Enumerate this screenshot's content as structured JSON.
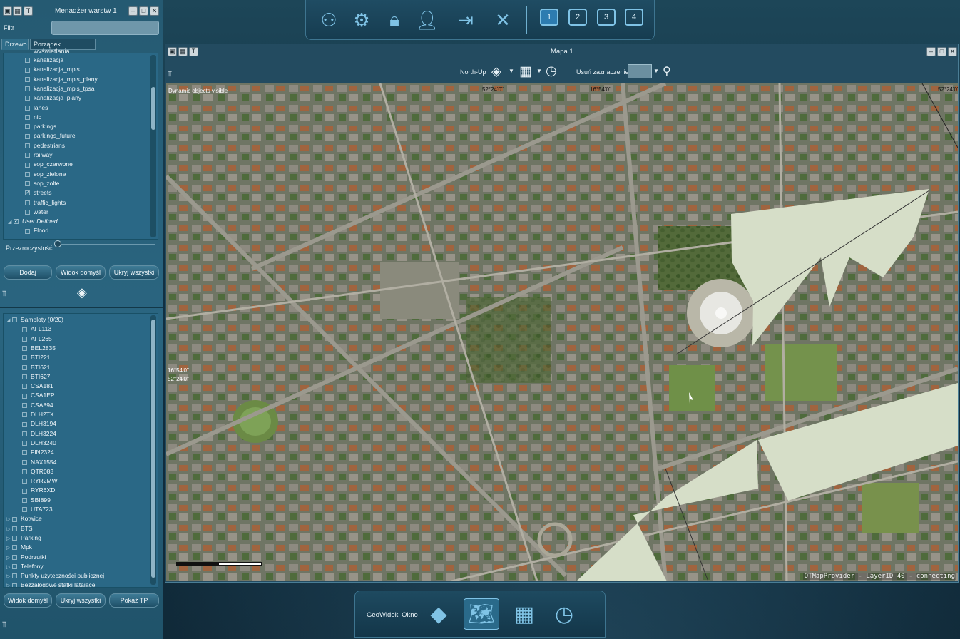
{
  "layers_panel": {
    "title": "Menadżer warstw 1",
    "filter_label": "Filtr",
    "filter_value": "",
    "tabs": [
      "Drzewo",
      "Porządek wyświetlania"
    ],
    "tree": [
      {
        "label": "kanalizacja",
        "checked": false
      },
      {
        "label": "kanalizacja_mpls",
        "checked": false
      },
      {
        "label": "kanalizacja_mpls_plany",
        "checked": false
      },
      {
        "label": "kanalizacja_mpls_tpsa",
        "checked": false
      },
      {
        "label": "kanalizacja_plany",
        "checked": false
      },
      {
        "label": "lanes",
        "checked": false
      },
      {
        "label": "nic",
        "checked": false
      },
      {
        "label": "parkings",
        "checked": false
      },
      {
        "label": "parkings_future",
        "checked": false
      },
      {
        "label": "pedestrians",
        "checked": false
      },
      {
        "label": "railway",
        "checked": false
      },
      {
        "label": "sop_czerwone",
        "checked": false
      },
      {
        "label": "sop_zielone",
        "checked": false
      },
      {
        "label": "sop_zolte",
        "checked": false
      },
      {
        "label": "streets",
        "checked": true
      },
      {
        "label": "traffic_lights",
        "checked": false
      },
      {
        "label": "water",
        "checked": false
      },
      {
        "label": "User Defined",
        "checked": true,
        "group": true
      },
      {
        "label": "Flood",
        "checked": false
      }
    ],
    "transparency_label": "Przezroczystość",
    "transparency_value": 0.03,
    "buttons": [
      "Dodaj",
      "Widok domyśl",
      "Ukryj wszystki"
    ]
  },
  "objects_panel": {
    "group": "Samoloty (0/20)",
    "aircraft": [
      "AFL113",
      "AFL265",
      "BEL2835",
      "BTI221",
      "BTI621",
      "BTI627",
      "CSA181",
      "CSA1EP",
      "CSA894",
      "DLH2TX",
      "DLH3194",
      "DLH3224",
      "DLH3240",
      "FIN2324",
      "NAX1554",
      "QTR083",
      "RYR2MW",
      "RYR6XD",
      "SBI899",
      "UTA723"
    ],
    "groups": [
      "Kotwice",
      "BTS",
      "Parking",
      "Mpk",
      "Podrzutki",
      "Telefony",
      "Punkty użyteczności publicznej",
      "Bezzałogowe statki latające"
    ],
    "buttons": [
      "Widok domyśl",
      "Ukryj wszystki",
      "Pokaż TP"
    ]
  },
  "top_toolbar": {
    "icons": [
      "network-icon",
      "satellite-icon",
      "lock-icon",
      "user-icon",
      "logout-icon",
      "close-icon"
    ],
    "screens": [
      "1",
      "2",
      "3",
      "4"
    ],
    "active_screen": "1"
  },
  "map_window": {
    "title": "Mapa 1",
    "orientation": "North-Up",
    "clear_selection": "Usuń zaznaczenie",
    "dynamic_label": "Dynamic objects visible",
    "coords": {
      "top1": "52°24'0\"",
      "top2": "16°54'0\"",
      "left1": "16°54'0\"",
      "left2": "52°24'0\"",
      "right1": "52°24'0\""
    },
    "status": "QTMapProvider - LayerID 40 - connecting"
  },
  "geo_bar": {
    "label": "GeoWidoki Okno",
    "icons": [
      "layers-icon",
      "world-map-icon",
      "grid-icon",
      "clock-icon"
    ],
    "active": "world-map-icon"
  },
  "colors": {
    "accent": "#7fc3e6",
    "panel": "#2a6886",
    "overlay": "#d6dec8"
  }
}
